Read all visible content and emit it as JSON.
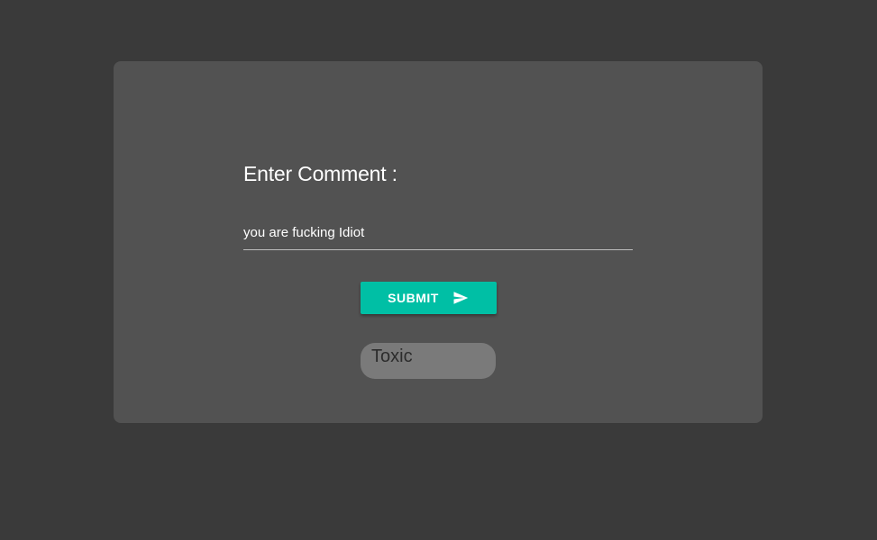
{
  "form": {
    "label": "Enter Comment :",
    "comment_value": "you are fucking Idiot",
    "submit_label": "SUBMIT",
    "submit_icon": "send-icon"
  },
  "result": {
    "label": "Toxic"
  },
  "colors": {
    "background": "#3a3a3a",
    "card": "#525252",
    "accent": "#00bfa5",
    "result_badge": "#7a7a7a"
  }
}
